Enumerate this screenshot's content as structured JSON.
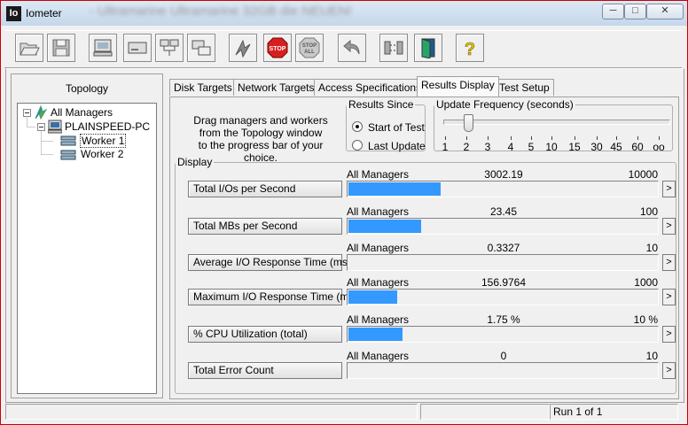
{
  "window": {
    "app_icon_text": "Io",
    "title": "Iometer",
    "blurred_title": "- Ultramarine Ultramarine 32GB die NEUEN!",
    "controls": {
      "minimize": "─",
      "maximize": "□",
      "close": "✕"
    }
  },
  "toolbar": {
    "buttons": [
      {
        "name": "open-icon"
      },
      {
        "name": "save-icon"
      },
      {
        "name": "new-manager-icon"
      },
      {
        "name": "new-disk-worker-icon"
      },
      {
        "name": "new-network-worker-icon"
      },
      {
        "name": "duplicate-worker-icon"
      },
      {
        "name": "start-tests-icon"
      },
      {
        "name": "stop-icon",
        "text": "STOP"
      },
      {
        "name": "stop-all-icon",
        "text": "STOP ALL"
      },
      {
        "name": "reset-workers-icon"
      },
      {
        "name": "disconnect-icon"
      },
      {
        "name": "exit-icon"
      },
      {
        "name": "help-icon",
        "text": "?"
      }
    ]
  },
  "topology": {
    "title": "Topology",
    "tree": {
      "root": "All Managers",
      "manager": "PLAINSPEED-PC",
      "workers": [
        "Worker 1",
        "Worker 2"
      ]
    }
  },
  "tabs": [
    {
      "label": "Disk Targets",
      "active": false
    },
    {
      "label": "Network Targets",
      "active": false
    },
    {
      "label": "Access Specifications",
      "active": false
    },
    {
      "label": "Results Display",
      "active": true
    },
    {
      "label": "Test Setup",
      "active": false
    }
  ],
  "results": {
    "instructions_line1": "Drag managers and workers",
    "instructions_line2": "from the Topology window",
    "instructions_line3": "to the progress bar of your choice.",
    "results_since": {
      "legend": "Results Since",
      "options": [
        "Start of Test",
        "Last Update"
      ],
      "selected": "Start of Test"
    },
    "update_frequency": {
      "legend": "Update Frequency (seconds)",
      "ticks": [
        "1",
        "2",
        "3",
        "4",
        "5",
        "10",
        "15",
        "30",
        "45",
        "60",
        "oo"
      ],
      "selected": "2"
    },
    "display_legend": "Display",
    "metrics": [
      {
        "label": "Total I/Os per Second",
        "source": "All Managers",
        "value": "3002.19",
        "max": "10000",
        "fill_fraction": 0.3
      },
      {
        "label": "Total MBs per Second",
        "source": "All Managers",
        "value": "23.45",
        "max": "100",
        "fill_fraction": 0.2345
      },
      {
        "label": "Average I/O Response Time (ms)",
        "source": "All Managers",
        "value": "0.3327",
        "max": "10",
        "fill_fraction": 0.0
      },
      {
        "label": "Maximum I/O Response Time (ms)",
        "source": "All Managers",
        "value": "156.9764",
        "max": "1000",
        "fill_fraction": 0.157
      },
      {
        "label": "% CPU Utilization (total)",
        "source": "All Managers",
        "value": "1.75 %",
        "max": "10 %",
        "fill_fraction": 0.175
      },
      {
        "label": "Total Error Count",
        "source": "All Managers",
        "value": "0",
        "max": "10",
        "fill_fraction": 0.0
      }
    ],
    "arrow_glyph": ">"
  },
  "statusbar": {
    "run": "Run 1 of 1"
  },
  "colors": {
    "bar_fill": "#3399ff",
    "window_border": "#cc0000"
  }
}
